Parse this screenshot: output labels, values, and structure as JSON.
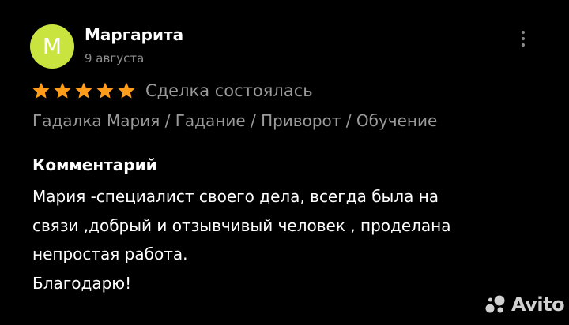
{
  "review": {
    "author": {
      "avatar_letter": "M",
      "avatar_color": "#c9e43f",
      "name": "Маргарита"
    },
    "date": "9 августа",
    "menu_icon": "more-vertical-icon",
    "rating": {
      "value": 5,
      "max": 5,
      "star_color": "#ff9d1b"
    },
    "deal_status": "Сделка состоялась",
    "item_breadcrumb": "Гадалка Мария / Гадание / Приворот / Обучение",
    "comment": {
      "heading": "Комментарий",
      "lines": [
        "Мария -специалист своего дела, всегда была на",
        "связи ,добрый и отзывчивый человек , проделана",
        "непростая работа.",
        "Благодарю!"
      ]
    }
  },
  "watermark": {
    "text": "Avito",
    "icon": "avito-logo-icon"
  },
  "colors": {
    "background": "#000000",
    "primary_text": "#ffffff",
    "secondary_text": "#9a9a9a"
  }
}
